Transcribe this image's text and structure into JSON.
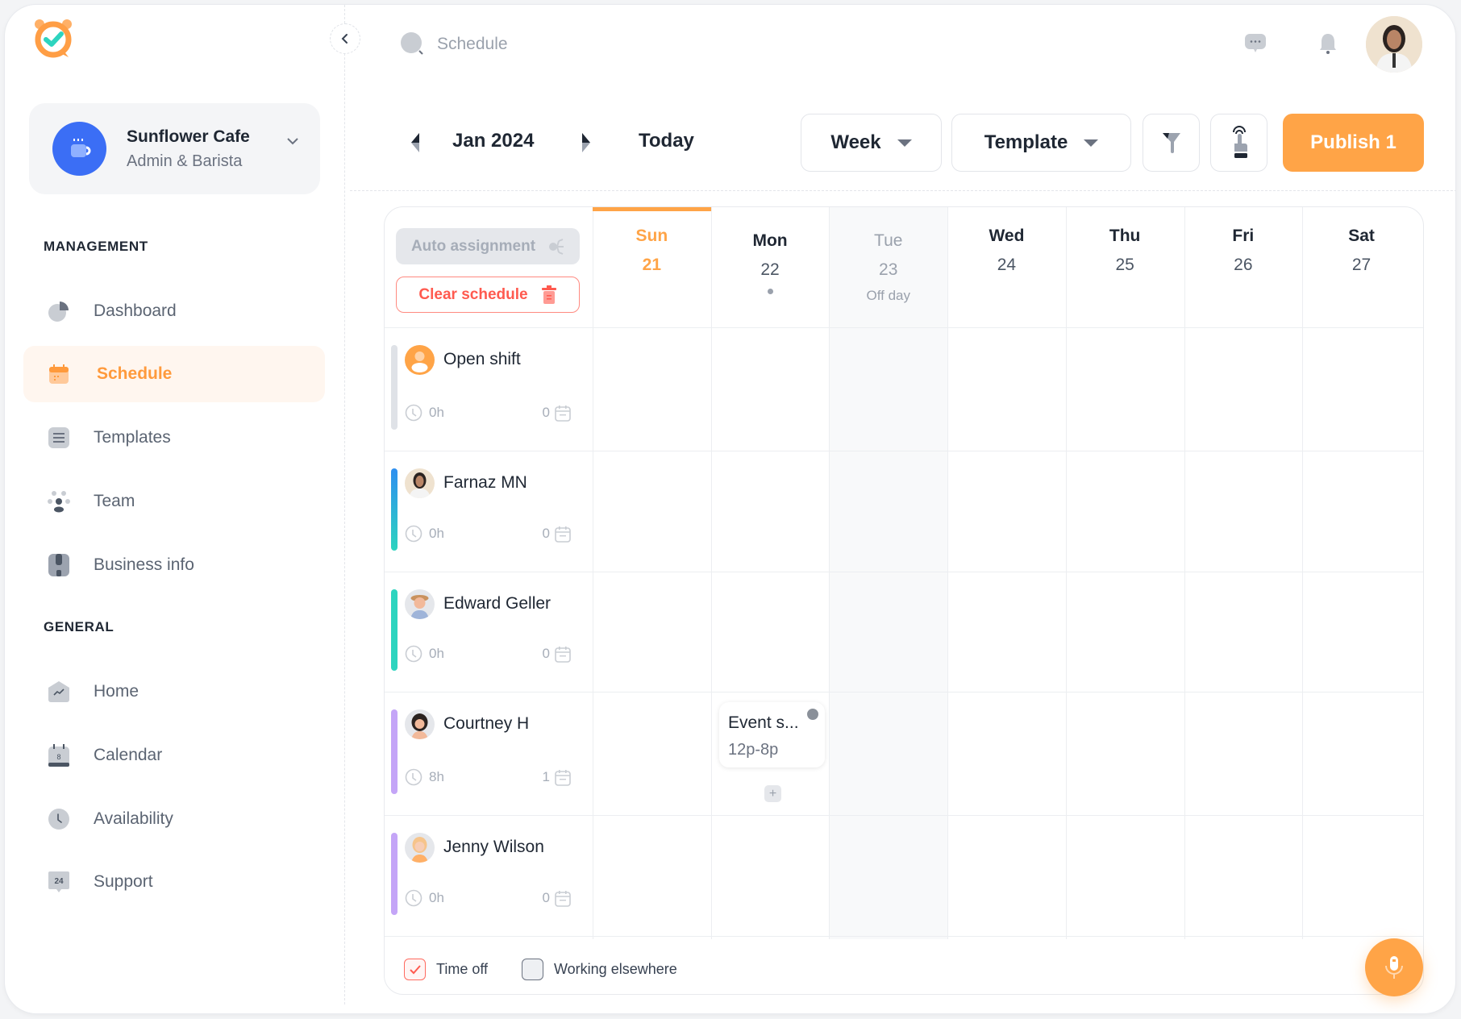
{
  "app": {
    "brand_colors": {
      "accent": "#ffa447",
      "danger": "#ff5a4f",
      "workspace": "#3b6ef5"
    }
  },
  "workspace": {
    "name": "Sunflower Cafe",
    "role": "Admin & Barista",
    "icon": "coffee-cup-icon"
  },
  "sidebar": {
    "collapse_icon": "chevron-left-icon",
    "sections": [
      {
        "label": "MANAGEMENT",
        "items": [
          {
            "label": "Dashboard",
            "icon": "pie-chart-icon",
            "active": false
          },
          {
            "label": "Schedule",
            "icon": "calendar-icon",
            "active": true
          },
          {
            "label": "Templates",
            "icon": "document-list-icon",
            "active": false
          },
          {
            "label": "Team",
            "icon": "team-icon",
            "active": false
          },
          {
            "label": "Business info",
            "icon": "shop-icon",
            "active": false
          }
        ]
      },
      {
        "label": "GENERAL",
        "items": [
          {
            "label": "Home",
            "icon": "home-chart-icon",
            "active": false
          },
          {
            "label": "Calendar",
            "icon": "calendar-date-icon",
            "active": false
          },
          {
            "label": "Availability",
            "icon": "clock-icon",
            "active": false
          },
          {
            "label": "Support",
            "icon": "support-24-icon",
            "active": false
          }
        ]
      }
    ]
  },
  "topbar": {
    "search_placeholder": "Schedule",
    "icons": [
      "chat-icon",
      "bell-icon",
      "user-avatar"
    ]
  },
  "toolbar": {
    "period_label": "Jan 2024",
    "today_label": "Today",
    "view_select": "Week",
    "template_select": "Template",
    "publish_label": "Publish 1",
    "filter_icon": "filter-icon",
    "touch_icon": "tap-icon"
  },
  "calendar": {
    "auto_assignment_label": "Auto assignment",
    "clear_schedule_label": "Clear schedule",
    "days": [
      {
        "name": "Sun",
        "num": "21",
        "today": true
      },
      {
        "name": "Mon",
        "num": "22",
        "has_dot": true
      },
      {
        "name": "Tue",
        "num": "23",
        "off": true,
        "off_label": "Off day"
      },
      {
        "name": "Wed",
        "num": "24"
      },
      {
        "name": "Thu",
        "num": "25"
      },
      {
        "name": "Fri",
        "num": "26"
      },
      {
        "name": "Sat",
        "num": "27"
      }
    ],
    "employees": [
      {
        "name": "Open shift",
        "hours": "0h",
        "shifts": "0",
        "bar_color": "#dfe2e7"
      },
      {
        "name": "Farnaz MN",
        "hours": "0h",
        "shifts": "0",
        "bar_color": "gradient-blue-teal"
      },
      {
        "name": "Edward Geller",
        "hours": "0h",
        "shifts": "0",
        "bar_color": "#2dd4bf"
      },
      {
        "name": "Courtney H",
        "hours": "8h",
        "shifts": "1",
        "bar_color": "#c4a5f7"
      },
      {
        "name": "Jenny Wilson",
        "hours": "0h",
        "shifts": "0",
        "bar_color": "#c4a5f7"
      }
    ],
    "event": {
      "employee": "Courtney H",
      "day": "Mon",
      "title": "Event s...",
      "time": "12p-8p"
    },
    "legend": [
      {
        "label": "Time off",
        "checked": true
      },
      {
        "label": "Working elsewhere",
        "checked": false
      }
    ],
    "mic_icon": "microphone-icon"
  }
}
